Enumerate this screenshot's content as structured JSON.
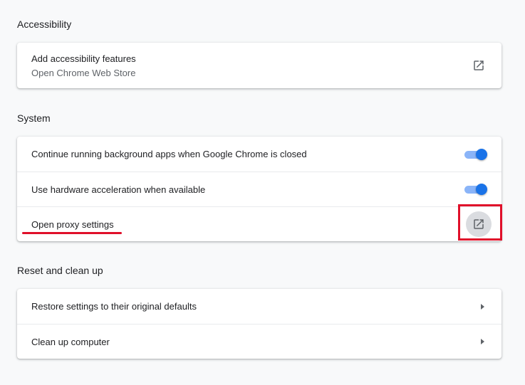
{
  "accessibility": {
    "heading": "Accessibility",
    "add_features": {
      "label": "Add accessibility features",
      "sublabel": "Open Chrome Web Store",
      "icon": "open-in-new-icon"
    }
  },
  "system": {
    "heading": "System",
    "background_apps": {
      "label": "Continue running background apps when Google Chrome is closed",
      "enabled": true
    },
    "hardware_acceleration": {
      "label": "Use hardware acceleration when available",
      "enabled": true
    },
    "proxy": {
      "label": "Open proxy settings",
      "icon": "open-in-new-icon"
    }
  },
  "reset": {
    "heading": "Reset and clean up",
    "restore": {
      "label": "Restore settings to their original defaults",
      "icon": "arrow-right-icon"
    },
    "cleanup": {
      "label": "Clean up computer",
      "icon": "arrow-right-icon"
    }
  },
  "colors": {
    "accent": "#1a73e8",
    "toggle_track": "#8ab4f8",
    "annotation": "#e0102a",
    "background": "#f8f9fa"
  }
}
